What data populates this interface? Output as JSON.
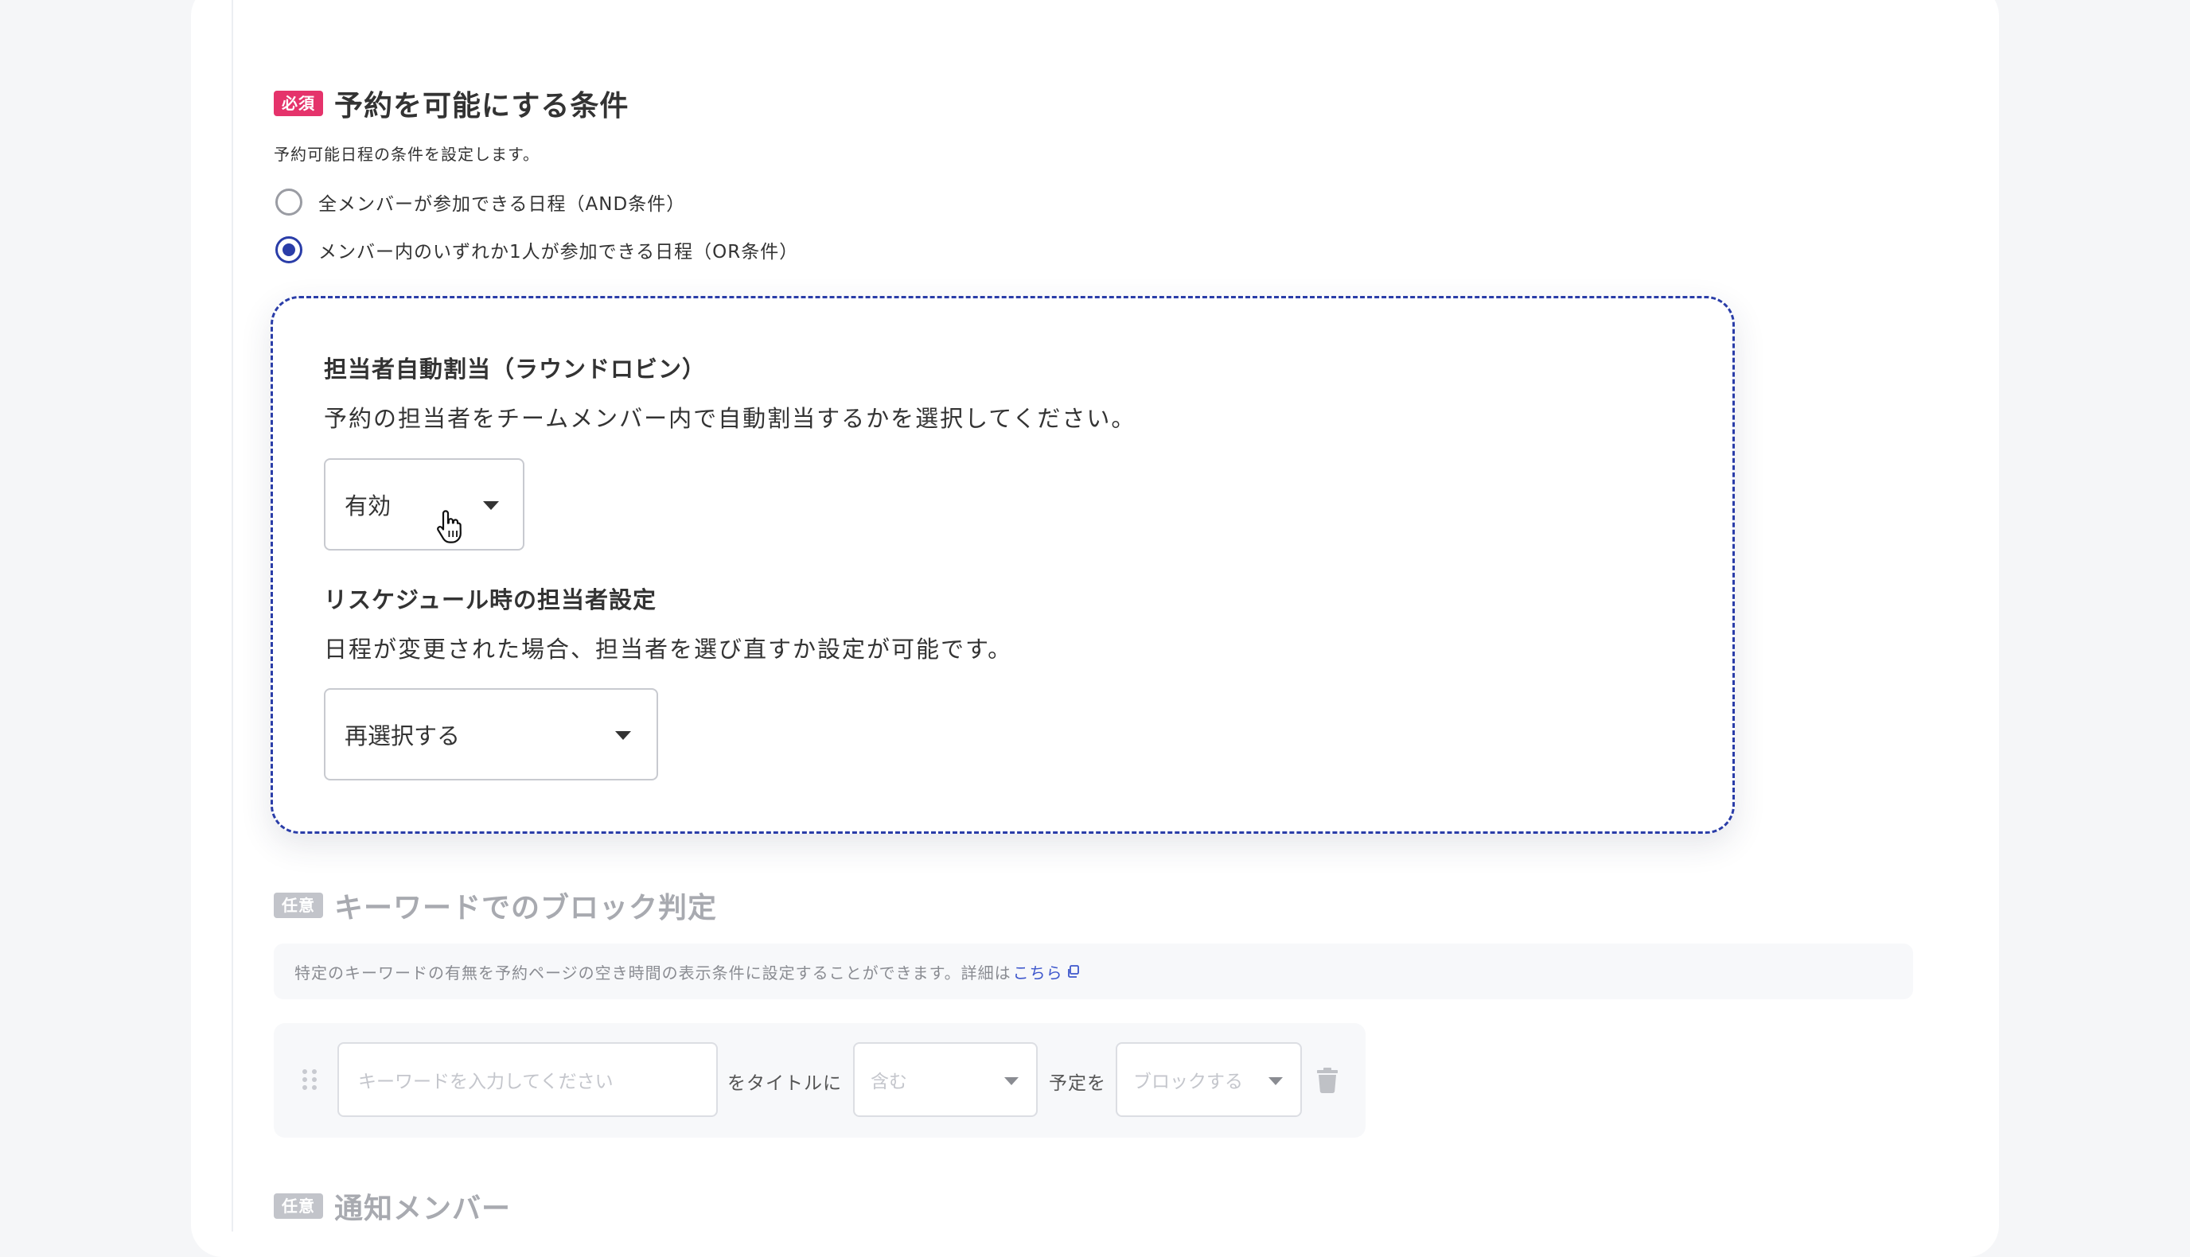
{
  "booking_condition": {
    "badge": "必須",
    "title": "予約を可能にする条件",
    "description": "予約可能日程の条件を設定します。",
    "options": [
      {
        "label": "全メンバーが参加できる日程（AND条件）",
        "checked": false
      },
      {
        "label": "メンバー内のいずれか1人が参加できる日程（OR条件）",
        "checked": true
      }
    ]
  },
  "round_robin": {
    "title": "担当者自動割当（ラウンドロビン）",
    "description": "予約の担当者をチームメンバー内で自動割当するかを選択してください。",
    "select_value": "有効"
  },
  "reschedule": {
    "title": "リスケジュール時の担当者設定",
    "description": "日程が変更された場合、担当者を選び直すか設定が可能です。",
    "select_value": "再選択する"
  },
  "keyword_block": {
    "badge": "任意",
    "title": "キーワードでのブロック判定",
    "info_text": "特定のキーワードの有無を予約ページの空き時間の表示条件に設定することができます。詳細は",
    "info_link": "こちら",
    "keyword_placeholder": "キーワードを入力してください",
    "title_label": "をタイトルに",
    "match_select": "含む",
    "event_label": "予定を",
    "action_select": "ブロックする"
  },
  "notify_members": {
    "badge": "任意",
    "title": "通知メンバー"
  },
  "colors": {
    "accent": "#2a3da8",
    "required_badge": "#e5336b",
    "optional_badge": "#c2c4ca",
    "link": "#3e57cc"
  },
  "icons": [
    "drag-handle-icon",
    "chevron-down-icon",
    "trash-icon",
    "external-link-icon",
    "hand-pointer-cursor"
  ]
}
